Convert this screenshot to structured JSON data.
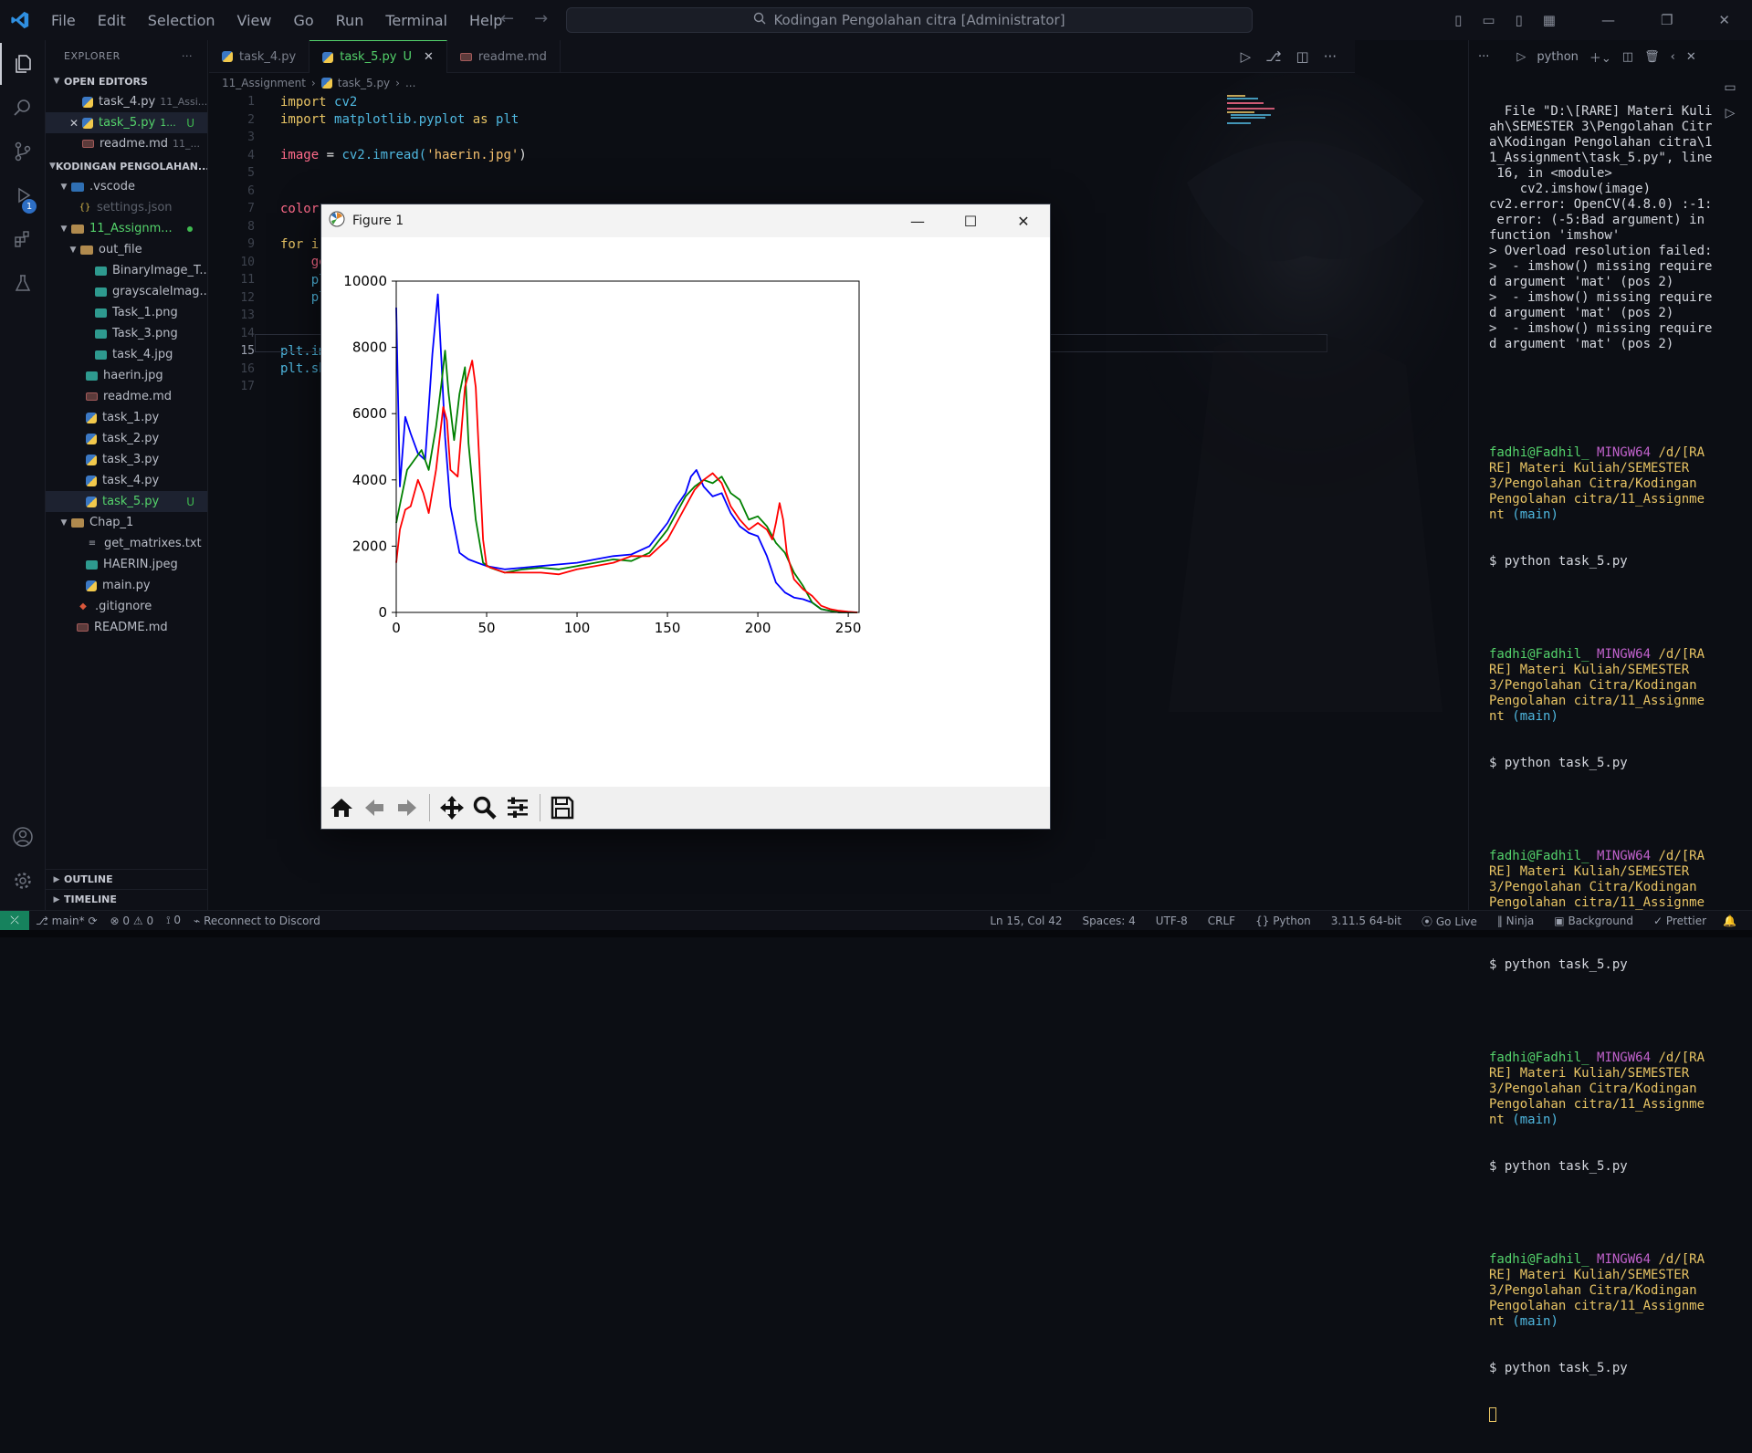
{
  "menu": [
    "File",
    "Edit",
    "Selection",
    "View",
    "Go",
    "Run",
    "Terminal",
    "Help"
  ],
  "command_center": "Kodingan Pengolahan citra [Administrator]",
  "activity_badge": "1",
  "sidebar": {
    "title": "EXPLORER",
    "open_editors_label": "OPEN EDITORS",
    "open_editors": [
      {
        "name": "task_4.py",
        "hint": "11_Assi..."
      },
      {
        "name": "task_5.py",
        "hint": "1...",
        "status": "U"
      },
      {
        "name": "readme.md",
        "hint": "11_..."
      }
    ],
    "workspace_label": "KODINGAN PENGOLAHAN...",
    "tree": {
      "vscode": ".vscode",
      "settings": "settings.json",
      "assignment": "11_Assignm...",
      "out_file": "out_file",
      "out_files": [
        "BinaryImage_T...",
        "grayscaleImag...",
        "Task_1.png",
        "Task_3.png",
        "task_4.jpg"
      ],
      "assignment_files": [
        "haerin.jpg",
        "readme.md",
        "task_1.py",
        "task_2.py",
        "task_3.py",
        "task_4.py",
        "task_5.py"
      ],
      "task5_status": "U",
      "chap1": "Chap_1",
      "chap1_files": [
        "get_matrixes.txt",
        "HAERIN.jpeg",
        "main.py"
      ],
      "root_files": [
        ".gitignore",
        "README.md"
      ]
    },
    "outline_label": "OUTLINE",
    "timeline_label": "TIMELINE"
  },
  "tabs": [
    {
      "name": "task_4.py"
    },
    {
      "name": "task_5.py",
      "status": "U"
    },
    {
      "name": "readme.md"
    }
  ],
  "breadcrumb": [
    "11_Assignment",
    "task_5.py",
    "..."
  ],
  "code": {
    "line_numbers": [
      "1",
      "2",
      "3",
      "4",
      "5",
      "6",
      "7",
      "8",
      "9",
      "10",
      "11",
      "12",
      "13",
      "14",
      "15",
      "16",
      "17"
    ],
    "l1_kw": "import",
    "l1_mod": "cv2",
    "l2_kw": "import",
    "l2_mod": "matplotlib.pyplot",
    "l2_as": "as",
    "l2_alias": "plt",
    "l4_var": "image",
    "l4_op": " = ",
    "l4_mod": "cv2",
    "l4_fn": ".imread(",
    "l4_str": "'haerin.jpg'",
    "l4_end": ")",
    "l7": "color",
    "l9": "for i",
    "l10": "ge",
    "l11": "pl",
    "l12": "pl",
    "l15": "plt.im",
    "l16": "plt.sh"
  },
  "figure": {
    "title": "Figure 1",
    "minimize": "—",
    "maximize": "☐",
    "close": "✕"
  },
  "chart_data": {
    "type": "line",
    "title": "",
    "xlabel": "",
    "ylabel": "",
    "xlim": [
      0,
      256
    ],
    "ylim": [
      0,
      10000
    ],
    "xticks": [
      0,
      50,
      100,
      150,
      200,
      250
    ],
    "yticks": [
      0,
      2000,
      4000,
      6000,
      8000,
      10000
    ],
    "grid": false,
    "series": [
      {
        "color": "#0000ff",
        "x": [
          0,
          2,
          5,
          8,
          12,
          16,
          20,
          23,
          25,
          27,
          30,
          35,
          40,
          45,
          50,
          60,
          70,
          80,
          90,
          100,
          110,
          120,
          130,
          140,
          150,
          155,
          160,
          163,
          166,
          170,
          175,
          180,
          185,
          190,
          195,
          200,
          205,
          210,
          215,
          220,
          225,
          230,
          235,
          240,
          245,
          250,
          255
        ],
        "y": [
          9200,
          3800,
          5900,
          5400,
          4800,
          4600,
          7800,
          9600,
          7600,
          5300,
          3200,
          1800,
          1600,
          1500,
          1400,
          1300,
          1350,
          1400,
          1450,
          1500,
          1600,
          1700,
          1750,
          2000,
          2700,
          3200,
          3600,
          4100,
          4300,
          3800,
          3500,
          3600,
          3000,
          2600,
          2400,
          2300,
          1700,
          900,
          600,
          450,
          400,
          300,
          100,
          50,
          0,
          0,
          0
        ]
      },
      {
        "color": "#008000",
        "x": [
          0,
          3,
          6,
          10,
          14,
          18,
          22,
          25,
          27,
          29,
          32,
          35,
          38,
          40,
          44,
          48,
          52,
          60,
          70,
          80,
          90,
          100,
          110,
          120,
          130,
          140,
          150,
          155,
          160,
          165,
          170,
          175,
          180,
          185,
          190,
          195,
          200,
          205,
          210,
          215,
          220,
          225,
          230,
          235,
          240,
          245,
          250,
          255
        ],
        "y": [
          2700,
          3500,
          4300,
          4600,
          4900,
          4300,
          5600,
          6900,
          7900,
          6600,
          5200,
          6600,
          7400,
          5100,
          2800,
          1500,
          1350,
          1200,
          1300,
          1350,
          1300,
          1400,
          1500,
          1600,
          1550,
          1800,
          2500,
          3000,
          3500,
          3800,
          4000,
          3900,
          4100,
          3600,
          3400,
          2800,
          2900,
          2600,
          2100,
          1800,
          1200,
          800,
          300,
          100,
          50,
          0,
          0,
          0
        ]
      },
      {
        "color": "#ff0000",
        "x": [
          0,
          2,
          5,
          8,
          12,
          15,
          18,
          22,
          26,
          28,
          30,
          34,
          38,
          42,
          44,
          46,
          48,
          50,
          55,
          60,
          70,
          80,
          90,
          100,
          110,
          120,
          130,
          140,
          150,
          155,
          160,
          165,
          170,
          175,
          180,
          185,
          190,
          195,
          200,
          205,
          208,
          210,
          212,
          214,
          216,
          220,
          225,
          230,
          235,
          240,
          245,
          250,
          255
        ],
        "y": [
          1500,
          2500,
          3100,
          3200,
          4000,
          3600,
          3000,
          4300,
          6200,
          5800,
          4300,
          4100,
          6800,
          7600,
          6800,
          4500,
          2200,
          1400,
          1300,
          1200,
          1200,
          1200,
          1150,
          1300,
          1400,
          1500,
          1700,
          1700,
          2200,
          2700,
          3200,
          3700,
          4000,
          4200,
          3900,
          3200,
          2800,
          2500,
          2700,
          2500,
          2200,
          2700,
          3300,
          2800,
          1800,
          1000,
          700,
          500,
          200,
          100,
          50,
          20,
          0
        ]
      }
    ]
  },
  "terminal": {
    "shell": "python",
    "error_block": "  File \"D:\\[RARE] Materi Kuli\nah\\SEMESTER 3\\Pengolahan Citr\na\\Kodingan Pengolahan citra\\1\n1_Assignment\\task_5.py\", line\n 16, in <module>\n    cv2.imshow(image)\ncv2.error: OpenCV(4.8.0) :-1:\n error: (-5:Bad argument) in\nfunction 'imshow'\n> Overload resolution failed:\n>  - imshow() missing require\nd argument 'mat' (pos 2)\n>  - imshow() missing require\nd argument 'mat' (pos 2)\n>  - imshow() missing require\nd argument 'mat' (pos 2)",
    "prompt_user": "fadhi@Fadhil_",
    "prompt_host": "MINGW64",
    "prompt_path": "/d/[RARE] Materi Kuliah/SEMESTER 3/Pengolahan Citra/Kodingan Pengolahan citra/11_Assignment",
    "prompt_branch": "(main)",
    "command": "$ python task_5.py"
  },
  "statusbar": {
    "branch": "main*",
    "errors": "0",
    "warnings": "0",
    "ports": "0",
    "discord": "Reconnect to Discord",
    "position": "Ln 15, Col 42",
    "spaces": "Spaces: 4",
    "encoding": "UTF-8",
    "eol": "CRLF",
    "language": "Python",
    "interpreter": "3.11.5 64-bit",
    "golive": "Go Live",
    "ninja": "Ninja",
    "background": "Background",
    "prettier": "Prettier"
  }
}
